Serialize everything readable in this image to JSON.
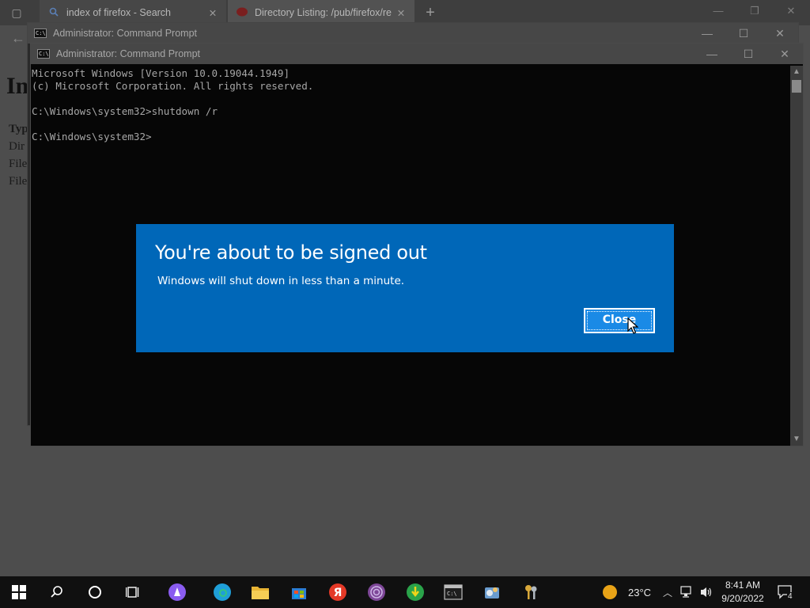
{
  "browser": {
    "tabs": [
      {
        "title": "index of firefox - Search",
        "icon": "search-icon"
      },
      {
        "title": "Directory Listing: /pub/firefox/re",
        "icon": "site-favicon"
      }
    ],
    "page": {
      "heading": "In",
      "lines": [
        "Typ",
        "Dir",
        "File",
        "File"
      ]
    }
  },
  "cmd_back": {
    "title": "Administrator: Command Prompt"
  },
  "cmd_front": {
    "title": "Administrator: Command Prompt",
    "console_lines": [
      "Microsoft Windows [Version 10.0.19044.1949]",
      "(c) Microsoft Corporation. All rights reserved.",
      "",
      "C:\\Windows\\system32>shutdown /r",
      "",
      "C:\\Windows\\system32>"
    ]
  },
  "dialog": {
    "title": "You're about to be signed out",
    "message": "Windows will shut down in less than a minute.",
    "close_label": "Close",
    "background": "#0067b8"
  },
  "taskbar": {
    "apps": [
      "start-icon",
      "search-icon",
      "cortana-icon",
      "task-view-icon",
      "alice-icon",
      "edge-icon",
      "file-explorer-icon",
      "store-icon",
      "yandex-icon",
      "tor-icon",
      "download-icon",
      "terminal-icon",
      "control-panel-icon",
      "keys-icon"
    ],
    "weather": "23°C",
    "time": "8:41 AM",
    "date": "9/20/2022",
    "notifications": "4"
  }
}
